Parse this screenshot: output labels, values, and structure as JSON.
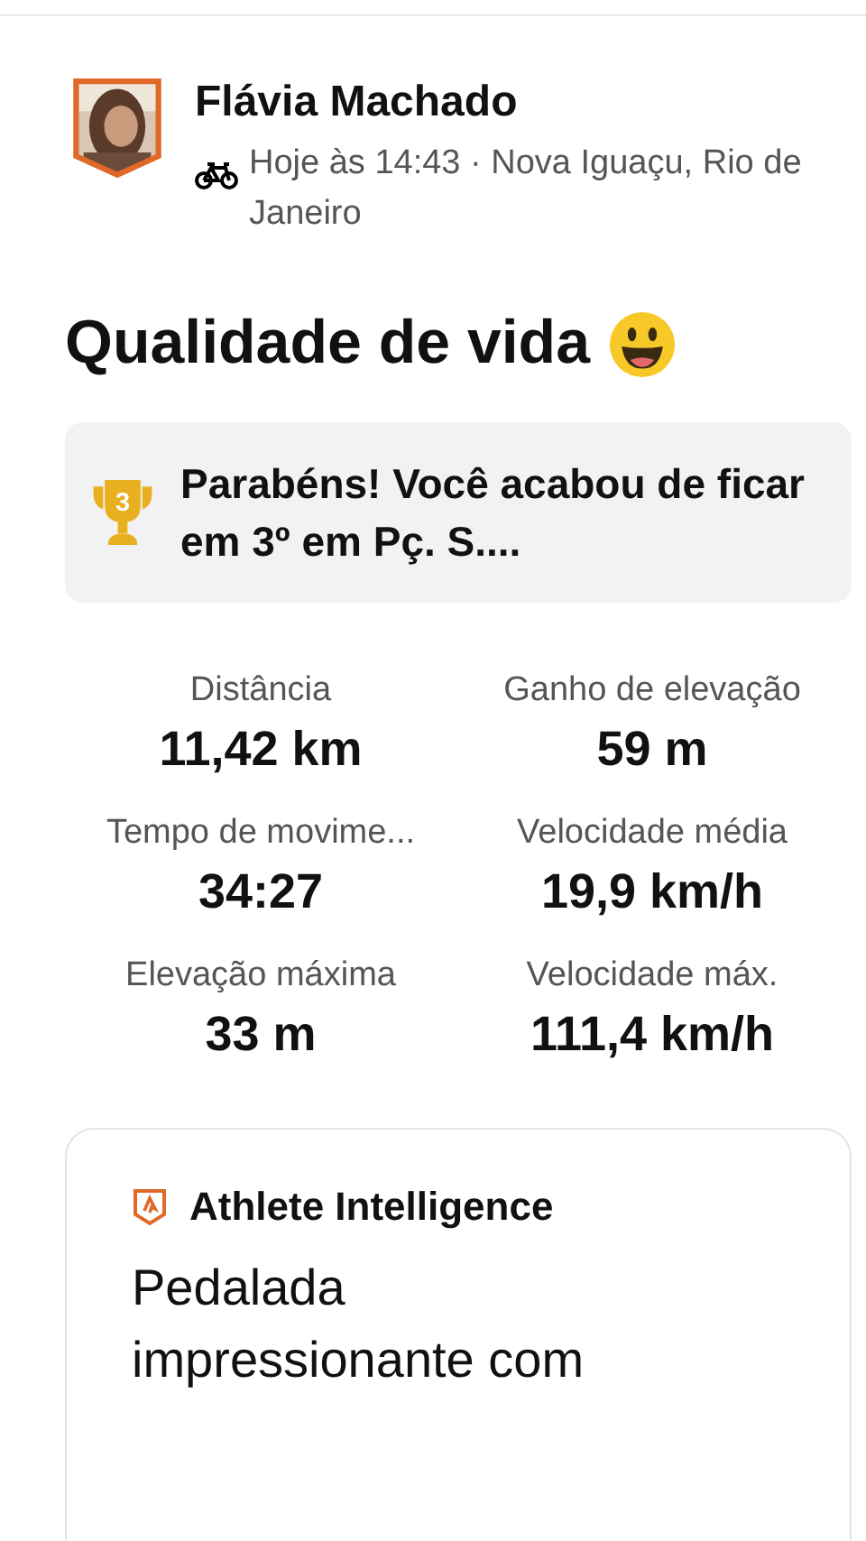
{
  "athlete": {
    "name": "Flávia Machado",
    "meta": "Hoje às 14:43 · Nova Iguaçu, Rio de Janeiro"
  },
  "title": "Qualidade de vida",
  "achievement": {
    "rank": "3",
    "text": "Parabéns! Você acabou de ficar em 3º em Pç. S...."
  },
  "stats": [
    {
      "label": "Distância",
      "value": "11,42 km"
    },
    {
      "label": "Ganho de elevação",
      "value": "59 m"
    },
    {
      "label": "Tempo de movime...",
      "value": "34:27"
    },
    {
      "label": "Velocidade média",
      "value": "19,9 km/h"
    },
    {
      "label": "Elevação máxima",
      "value": "33 m"
    },
    {
      "label": "Velocidade máx.",
      "value": "111,4 km/h"
    }
  ],
  "insight": {
    "title": "Athlete Intelligence",
    "body": "Pedalada impressionante com"
  }
}
